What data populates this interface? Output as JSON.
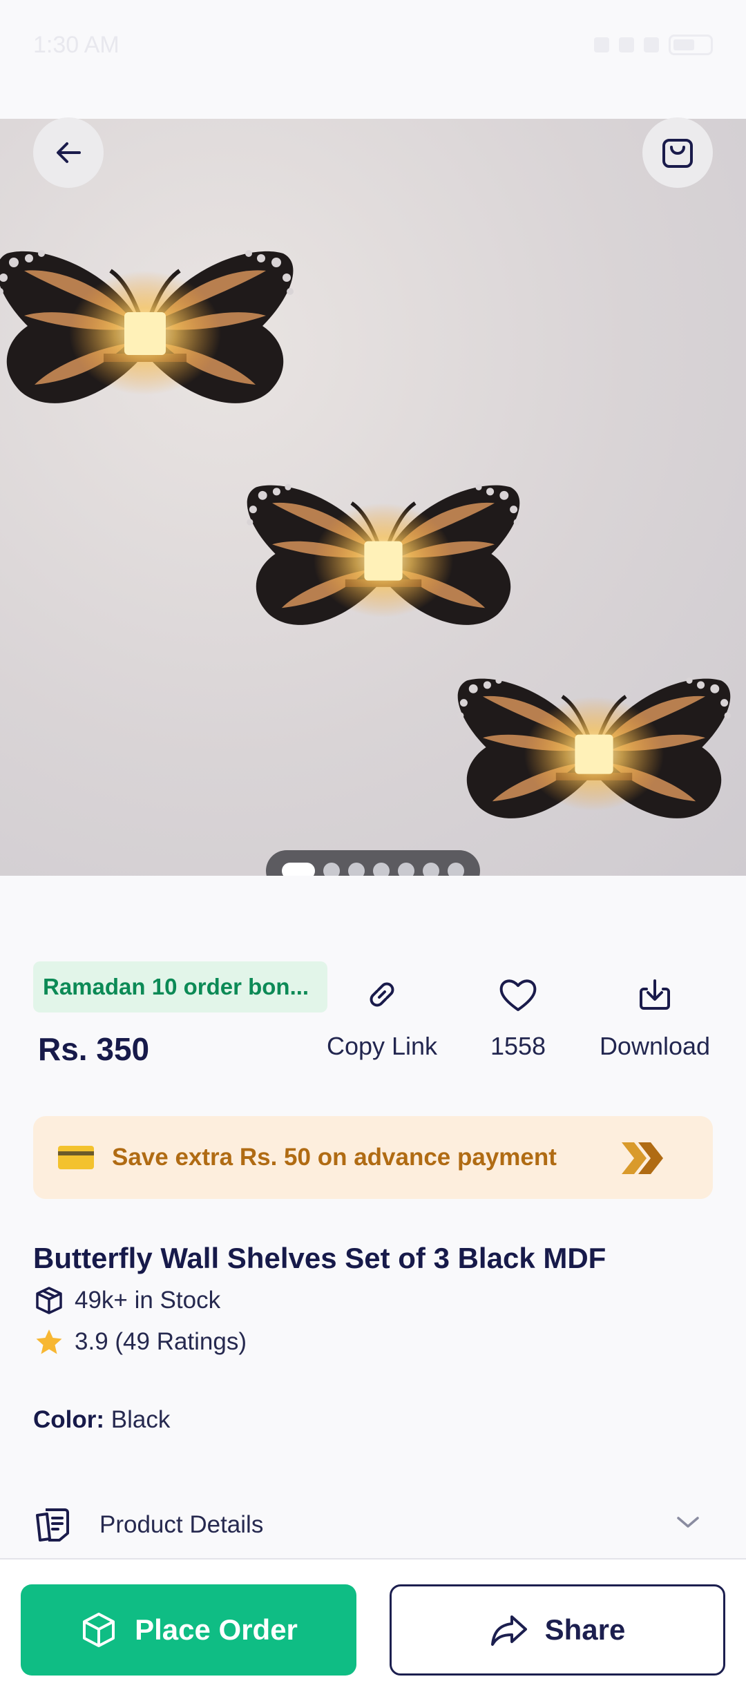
{
  "status_bar": {
    "time": "1:30 AM"
  },
  "hero": {
    "image_alt": "butterfly-wall-shelves-photo",
    "dots_count": 7,
    "active_dot": 0
  },
  "nav": {
    "back_icon": "arrow-left-icon",
    "cart_icon": "shopping-bag-icon"
  },
  "promo": {
    "badge": "Ramadan 10 order bon..."
  },
  "price": "Rs. 350",
  "actions": {
    "copy_link": "Copy Link",
    "likes": "1558",
    "download": "Download"
  },
  "banner": {
    "text": "Save extra Rs. 50 on advance payment"
  },
  "product": {
    "title": "Butterfly Wall Shelves Set of 3 Black MDF",
    "stock": "49k+ in Stock",
    "rating": "3.9 (49 Ratings)",
    "color_label": "Color:",
    "color_value": "Black",
    "details_label": "Product Details"
  },
  "bottom": {
    "place_order": "Place Order",
    "share": "Share"
  },
  "colors": {
    "primary_green": "#0fbd84",
    "navy": "#1c1f4f",
    "banner_bg": "#fdeedd",
    "banner_text": "#b06b13",
    "badge_green": "#0c8a56"
  }
}
